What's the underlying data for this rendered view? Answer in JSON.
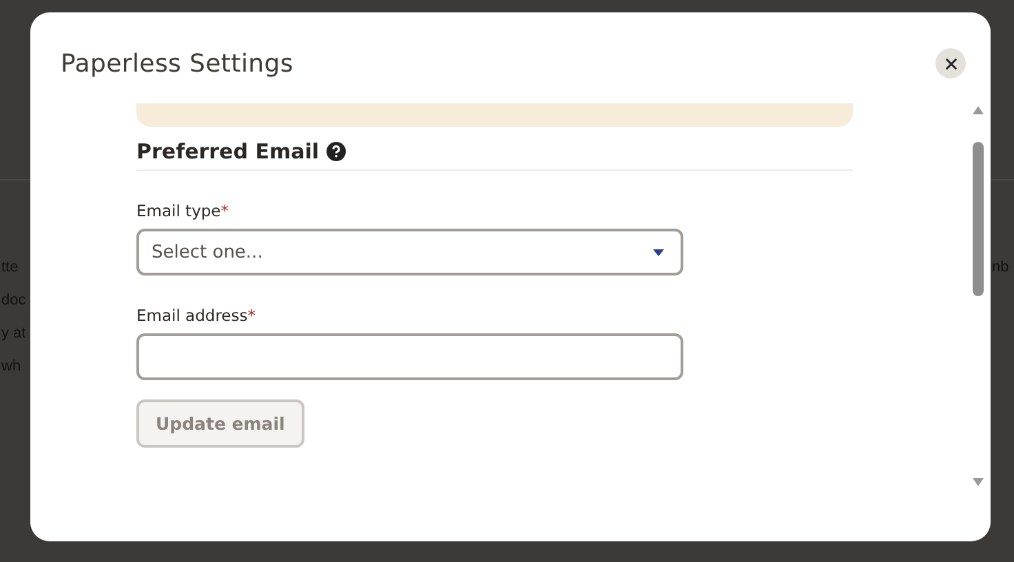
{
  "background_page": {
    "left_fragments": [
      "tte",
      "doc",
      "y at",
      "wh"
    ],
    "right_fragments": [
      "nb"
    ]
  },
  "dialog": {
    "title": "Paperless Settings",
    "section": {
      "heading": "Preferred Email",
      "fields": [
        {
          "kind": "select",
          "label": "Email type",
          "required_mark": "*",
          "placeholder": "Select one..."
        },
        {
          "kind": "text",
          "label": "Email address",
          "required_mark": "*"
        }
      ],
      "button": {
        "label": "Update email",
        "disabled": true
      }
    }
  }
}
